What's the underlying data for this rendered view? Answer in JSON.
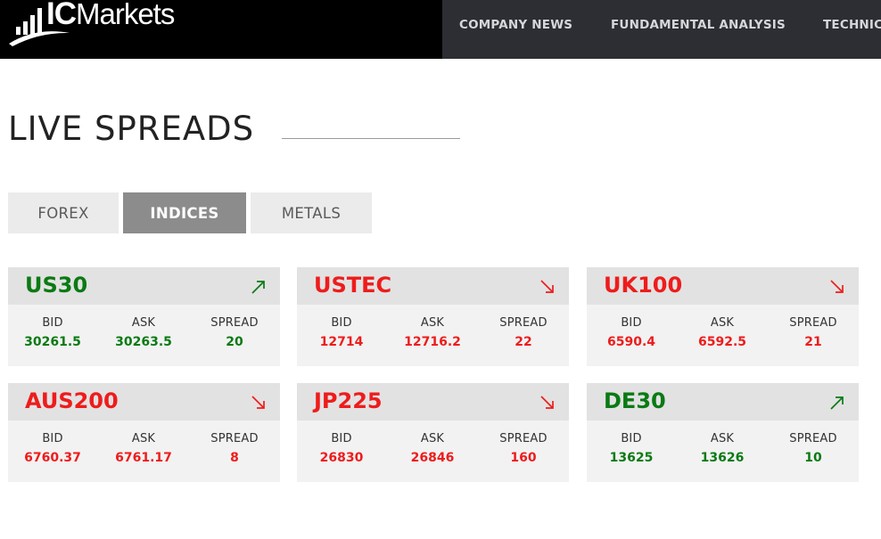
{
  "brand": {
    "logo_ic": "IC",
    "logo_text": "Markets"
  },
  "nav": {
    "items": [
      "COMPANY NEWS",
      "FUNDAMENTAL ANALYSIS",
      "TECHNICAL ANALYSIS"
    ]
  },
  "title": "LIVE SPREADS",
  "tabs": [
    {
      "label": "FOREX",
      "active": false
    },
    {
      "label": "INDICES",
      "active": true
    },
    {
      "label": "METALS",
      "active": false
    }
  ],
  "columns": {
    "bid": "BID",
    "ask": "ASK",
    "spread": "SPREAD"
  },
  "colors": {
    "up": "#0a7a13",
    "down": "#ee1c1c",
    "active_tab": "#8c8c8c"
  },
  "instruments": [
    {
      "symbol": "US30",
      "direction": "up",
      "icon": "arrow-up-right-icon",
      "bid": "30261.5",
      "ask": "30263.5",
      "spread": "20"
    },
    {
      "symbol": "USTEC",
      "direction": "down",
      "icon": "arrow-down-right-icon",
      "bid": "12714",
      "ask": "12716.2",
      "spread": "22"
    },
    {
      "symbol": "UK100",
      "direction": "down",
      "icon": "arrow-down-right-icon",
      "bid": "6590.4",
      "ask": "6592.5",
      "spread": "21"
    },
    {
      "symbol": "AUS200",
      "direction": "down",
      "icon": "arrow-down-right-icon",
      "bid": "6760.37",
      "ask": "6761.17",
      "spread": "8"
    },
    {
      "symbol": "JP225",
      "direction": "down",
      "icon": "arrow-down-right-icon",
      "bid": "26830",
      "ask": "26846",
      "spread": "160"
    },
    {
      "symbol": "DE30",
      "direction": "up",
      "icon": "arrow-up-right-icon",
      "bid": "13625",
      "ask": "13626",
      "spread": "10"
    }
  ]
}
